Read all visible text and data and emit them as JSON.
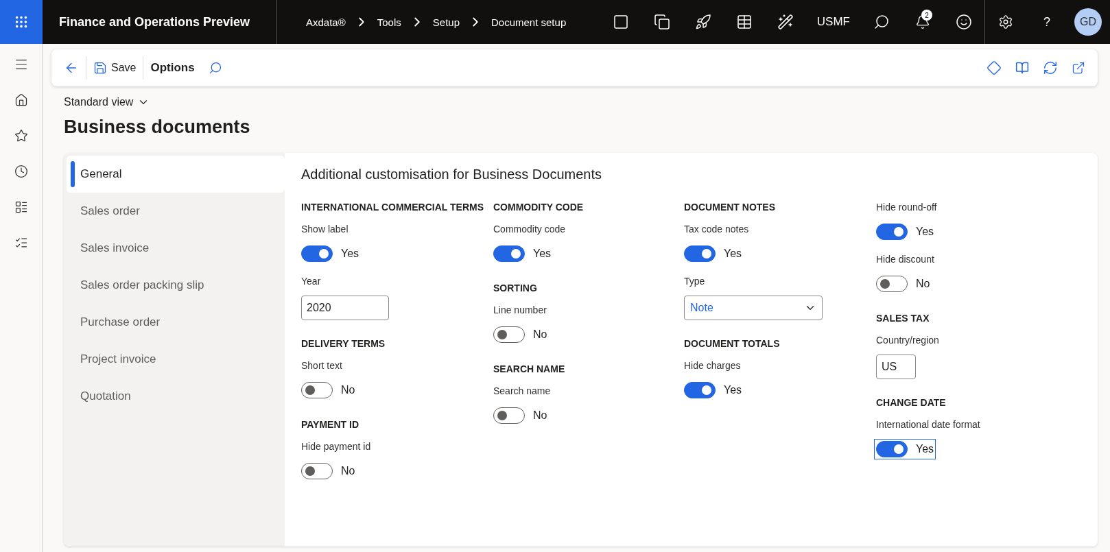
{
  "app_bar": {
    "app_title": "Finance and Operations Preview",
    "breadcrumbs": [
      "Axdata®",
      "Tools",
      "Setup",
      "Document setup"
    ],
    "company": "USMF",
    "notification_count": "2",
    "help": "?",
    "avatar_initials": "GD"
  },
  "toolbar": {
    "save": "Save",
    "options": "Options"
  },
  "view_selector": "Standard view",
  "page_title": "Business documents",
  "tabs": [
    {
      "label": "General",
      "selected": true
    },
    {
      "label": "Sales order",
      "selected": false
    },
    {
      "label": "Sales invoice",
      "selected": false
    },
    {
      "label": "Sales order packing slip",
      "selected": false
    },
    {
      "label": "Purchase order",
      "selected": false
    },
    {
      "label": "Project invoice",
      "selected": false
    },
    {
      "label": "Quotation",
      "selected": false
    }
  ],
  "form_title": "Additional customisation for Business Documents",
  "columns": [
    {
      "sections": [
        {
          "heading": "INTERNATIONAL COMMERCIAL TERMS",
          "fields": [
            {
              "kind": "toggle",
              "label": "Show label",
              "on": true,
              "value_text": "Yes",
              "focused": false
            },
            {
              "kind": "input",
              "label": "Year",
              "value": "2020"
            }
          ]
        },
        {
          "heading": "DELIVERY TERMS",
          "fields": [
            {
              "kind": "toggle",
              "label": "Short text",
              "on": false,
              "value_text": "No",
              "focused": false
            }
          ]
        },
        {
          "heading": "PAYMENT ID",
          "fields": [
            {
              "kind": "toggle",
              "label": "Hide payment id",
              "on": false,
              "value_text": "No",
              "focused": false
            }
          ]
        }
      ]
    },
    {
      "sections": [
        {
          "heading": "COMMODITY CODE",
          "fields": [
            {
              "kind": "toggle",
              "label": "Commodity code",
              "on": true,
              "value_text": "Yes",
              "focused": false
            }
          ]
        },
        {
          "heading": "SORTING",
          "fields": [
            {
              "kind": "toggle",
              "label": "Line number",
              "on": false,
              "value_text": "No",
              "focused": false
            }
          ]
        },
        {
          "heading": "SEARCH NAME",
          "fields": [
            {
              "kind": "toggle",
              "label": "Search name",
              "on": false,
              "value_text": "No",
              "focused": false
            }
          ]
        }
      ]
    },
    {
      "sections": [
        {
          "heading": "DOCUMENT NOTES",
          "fields": [
            {
              "kind": "toggle",
              "label": "Tax code notes",
              "on": true,
              "value_text": "Yes",
              "focused": false
            },
            {
              "kind": "select",
              "label": "Type",
              "value": "Note"
            }
          ]
        },
        {
          "heading": "DOCUMENT TOTALS",
          "fields": [
            {
              "kind": "toggle",
              "label": "Hide charges",
              "on": true,
              "value_text": "Yes",
              "focused": false
            }
          ]
        }
      ]
    },
    {
      "sections": [
        {
          "fields": [
            {
              "kind": "toggle",
              "label": "Hide round-off",
              "on": true,
              "value_text": "Yes",
              "focused": false
            },
            {
              "kind": "toggle",
              "label": "Hide discount",
              "on": false,
              "value_text": "No",
              "focused": false
            }
          ]
        },
        {
          "heading": "SALES TAX",
          "fields": [
            {
              "kind": "input",
              "label": "Country/region",
              "value": "US"
            }
          ]
        },
        {
          "heading": "CHANGE DATE",
          "fields": [
            {
              "kind": "toggle",
              "label": "International date format",
              "on": true,
              "value_text": "Yes",
              "focused": true
            }
          ]
        }
      ]
    }
  ]
}
